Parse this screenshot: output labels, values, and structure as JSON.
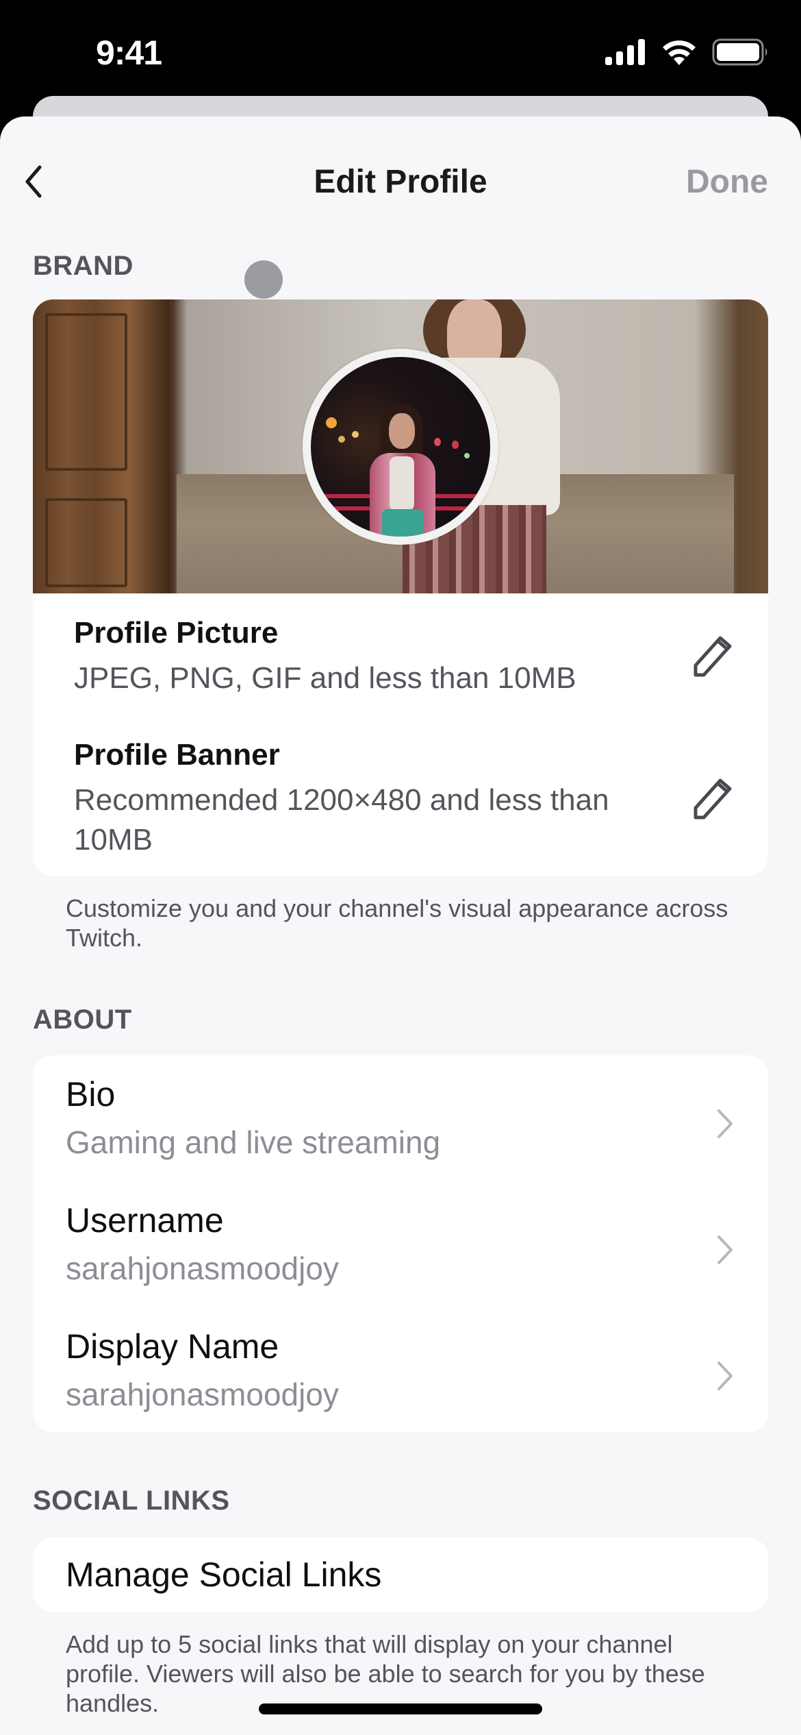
{
  "status_bar": {
    "time": "9:41",
    "icons": [
      "cellular-signal-icon",
      "wifi-icon",
      "battery-icon"
    ]
  },
  "nav": {
    "back_icon": "chevron-left-icon",
    "title": "Edit Profile",
    "done_label": "Done"
  },
  "brand": {
    "section_label": "BRAND",
    "profile_picture": {
      "title": "Profile Picture",
      "subtitle": "JPEG, PNG, GIF and less than 10MB",
      "icon": "pencil-icon"
    },
    "profile_banner": {
      "title": "Profile Banner",
      "subtitle": "Recommended 1200×480 and less than 10MB",
      "icon": "pencil-icon"
    },
    "footnote": "Customize you and your channel's visual appearance across Twitch."
  },
  "about": {
    "section_label": "ABOUT",
    "items": [
      {
        "label": "Bio",
        "value": "Gaming and live streaming"
      },
      {
        "label": "Username",
        "value": "sarahjonasmoodjoy"
      },
      {
        "label": "Display Name",
        "value": "sarahjonasmoodjoy"
      }
    ]
  },
  "social_links": {
    "section_label": "SOCIAL LINKS",
    "manage_label": "Manage Social Links",
    "footnote": "Add up to 5 social links that will display on your channel profile. Viewers will also be able to search for you by these handles."
  },
  "colors": {
    "background": "#f7f6f9",
    "card": "#ffffff",
    "primary_text": "#111111",
    "secondary_text": "#55545c",
    "muted_text": "#8e8d95",
    "done_disabled": "#9a99a0"
  }
}
